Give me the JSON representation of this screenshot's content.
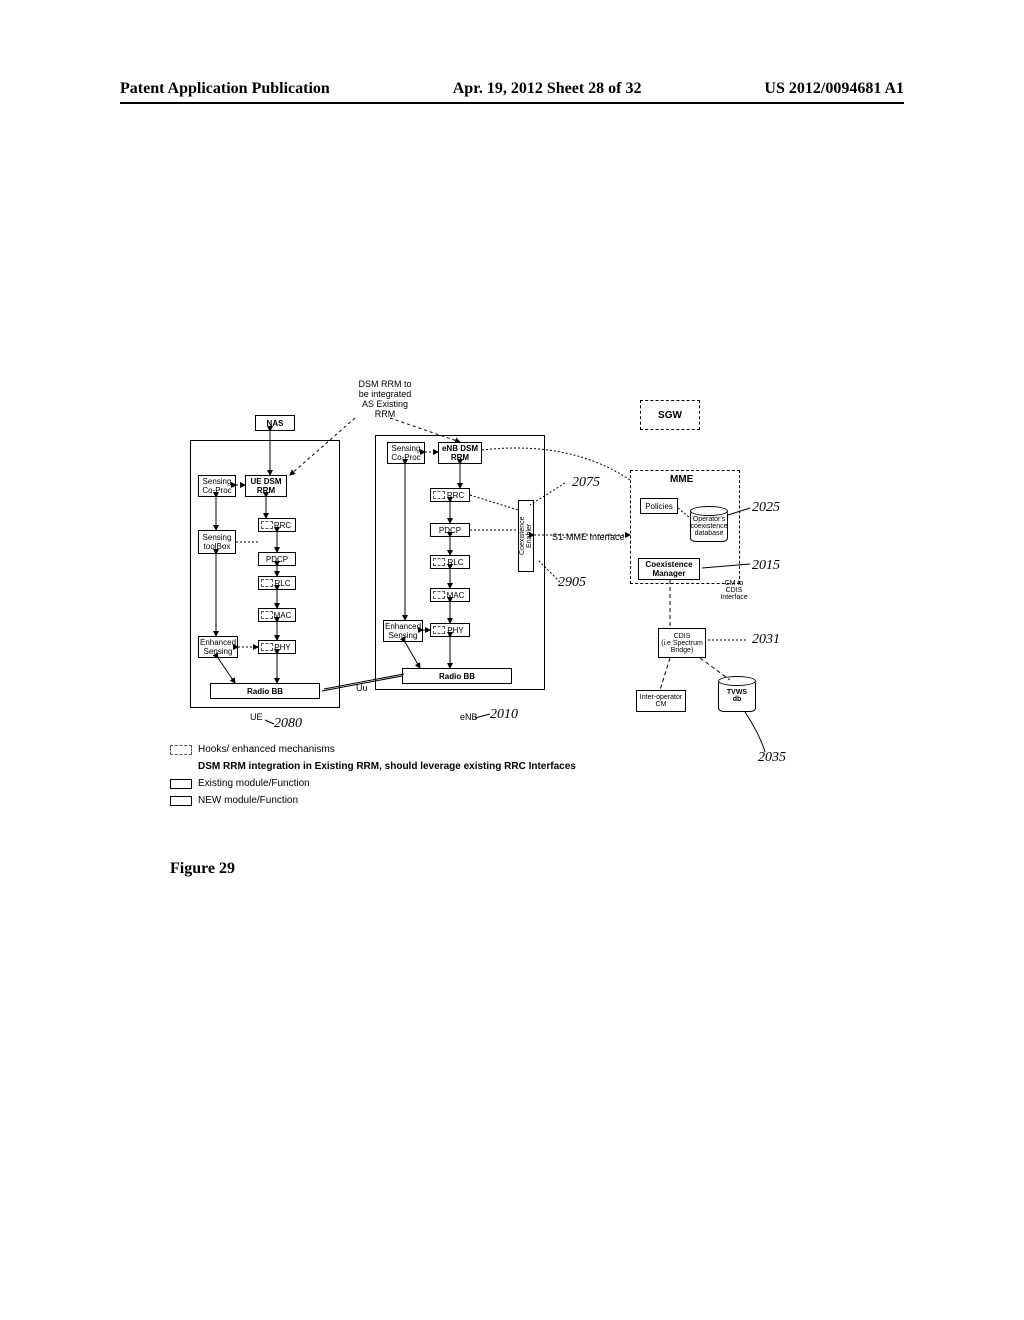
{
  "header": {
    "left": "Patent Application Publication",
    "center": "Apr. 19, 2012  Sheet 28 of 32",
    "right": "US 2012/0094681 A1"
  },
  "top_note": "DSM RRM to\nbe integrated\nAS Existing\nRRM",
  "ue_block": {
    "label": "UE",
    "nas": "NAS",
    "sensing_coproc": "Sensing\nCo-Proc",
    "ue_dsm_rrm": "UE DSM\nRRM",
    "sensing_toolbox": "Sensing\ntoolBox",
    "rrc": "RRC",
    "pdcp": "PDCP",
    "rlc": "RLC",
    "mac": "MAC",
    "phy": "PHY",
    "enhanced_sensing": "Enhanced\nSensing",
    "radio_bb": "Radio BB"
  },
  "enb_block": {
    "label": "eNB",
    "sensing_coproc": "Sensing\nCo-Proc",
    "enb_dsm_rrm": "eNB DSM\nRRM",
    "rrc": "RRC",
    "pdcp": "PDCP",
    "rlc": "RLC",
    "mac": "MAC",
    "phy": "PHY",
    "enhanced_sensing": "Enhanced\nSensing",
    "radio_bb": "Radio BB",
    "coexistence_enabler": "Coexistence\nEnabler"
  },
  "network": {
    "sgw": "SGW",
    "mme": "MME",
    "policies": "Policies",
    "operators_db": "Operator's\ncoexistence\ndatabase",
    "coexistence_manager": "Coexistence\nManager",
    "cm_to_cdis": "CM to\nCDIS\nInterface",
    "cdis": "CDIS\n(i.e Spectrum\nBridge)",
    "inter_op_cm": "Inter-operator\nCM",
    "tvws_db": "TVWS\ndb",
    "s1_mme_interface": "S1-MME Interface"
  },
  "uu_label": "Uu",
  "ref_numerals": {
    "r2075": "2075",
    "r2025": "2025",
    "r2015": "2015",
    "r2031": "2031",
    "r2035": "2035",
    "r2905": "2905",
    "r2010": "2010",
    "r2080": "2080"
  },
  "legend": {
    "hooks": "Hooks/ enhanced mechanisms",
    "note": "DSM RRM integration in Existing RRM, should leverage existing RRC Interfaces",
    "existing": "Existing module/Function",
    "newmod": "NEW module/Function"
  },
  "figure_caption": "Figure 29"
}
